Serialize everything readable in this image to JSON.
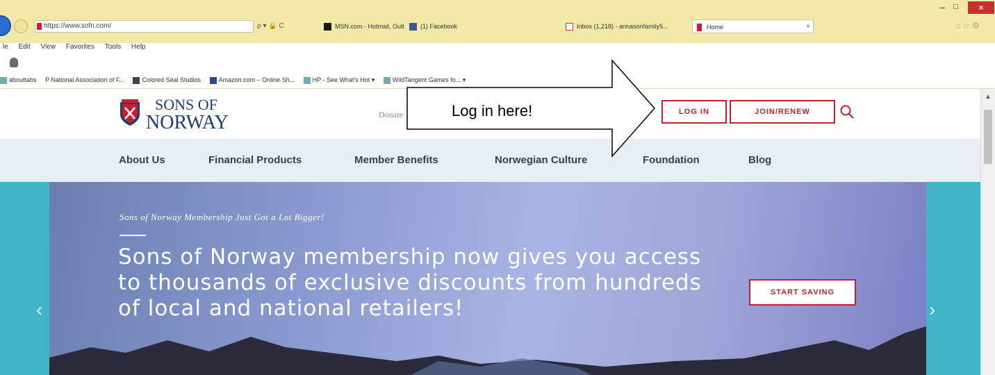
{
  "browser": {
    "address_url": "https://www.sofn.com/",
    "address_tools": "ρ ▾ 🔒 C",
    "tabs": [
      {
        "label": "MSN.com - Hotmail, Outlook, ..."
      },
      {
        "label": "(1) Facebook"
      },
      {
        "label": "Inbox (1,218) - annasonfamily5..."
      },
      {
        "label": "Home"
      }
    ],
    "tab_close": "×",
    "window_controls": {
      "minimize": "–",
      "maximize": "□",
      "close": "×"
    },
    "right_icons": "⌂☆⚙",
    "menu": [
      "le",
      "Edit",
      "View",
      "Favorites",
      "Tools",
      "Help"
    ],
    "favorites": [
      "abouttabs",
      "P National Association of F...",
      "Colored Seal Studios",
      "Amazon.com – Online Sh...",
      "HP - See What's Hot ▾",
      "WildTangent Games fo... ▾"
    ]
  },
  "site": {
    "logo": {
      "line1": "SONS OF",
      "line2": "NORWAY"
    },
    "donate": "Donate",
    "login_label": "LOG IN",
    "join_label": "JOIN/RENEW",
    "nav": [
      "About Us",
      "Financial Products",
      "Member Benefits",
      "Norwegian Culture",
      "Foundation",
      "Blog"
    ],
    "hero": {
      "kicker": "Sons of Norway Membership Just Got a Lot Bigger!",
      "headline": "Sons of Norway membership now gives you access to thousands of exclusive discounts from hundreds of local and national retailers!",
      "cta": "START SAVING"
    },
    "carousel": {
      "prev": "‹",
      "next": "›"
    },
    "brand_color": "#c61f2f",
    "navy": "#1f3c7a",
    "teal": "#3fb6c8"
  },
  "annotation": {
    "text": "Log in here!"
  }
}
